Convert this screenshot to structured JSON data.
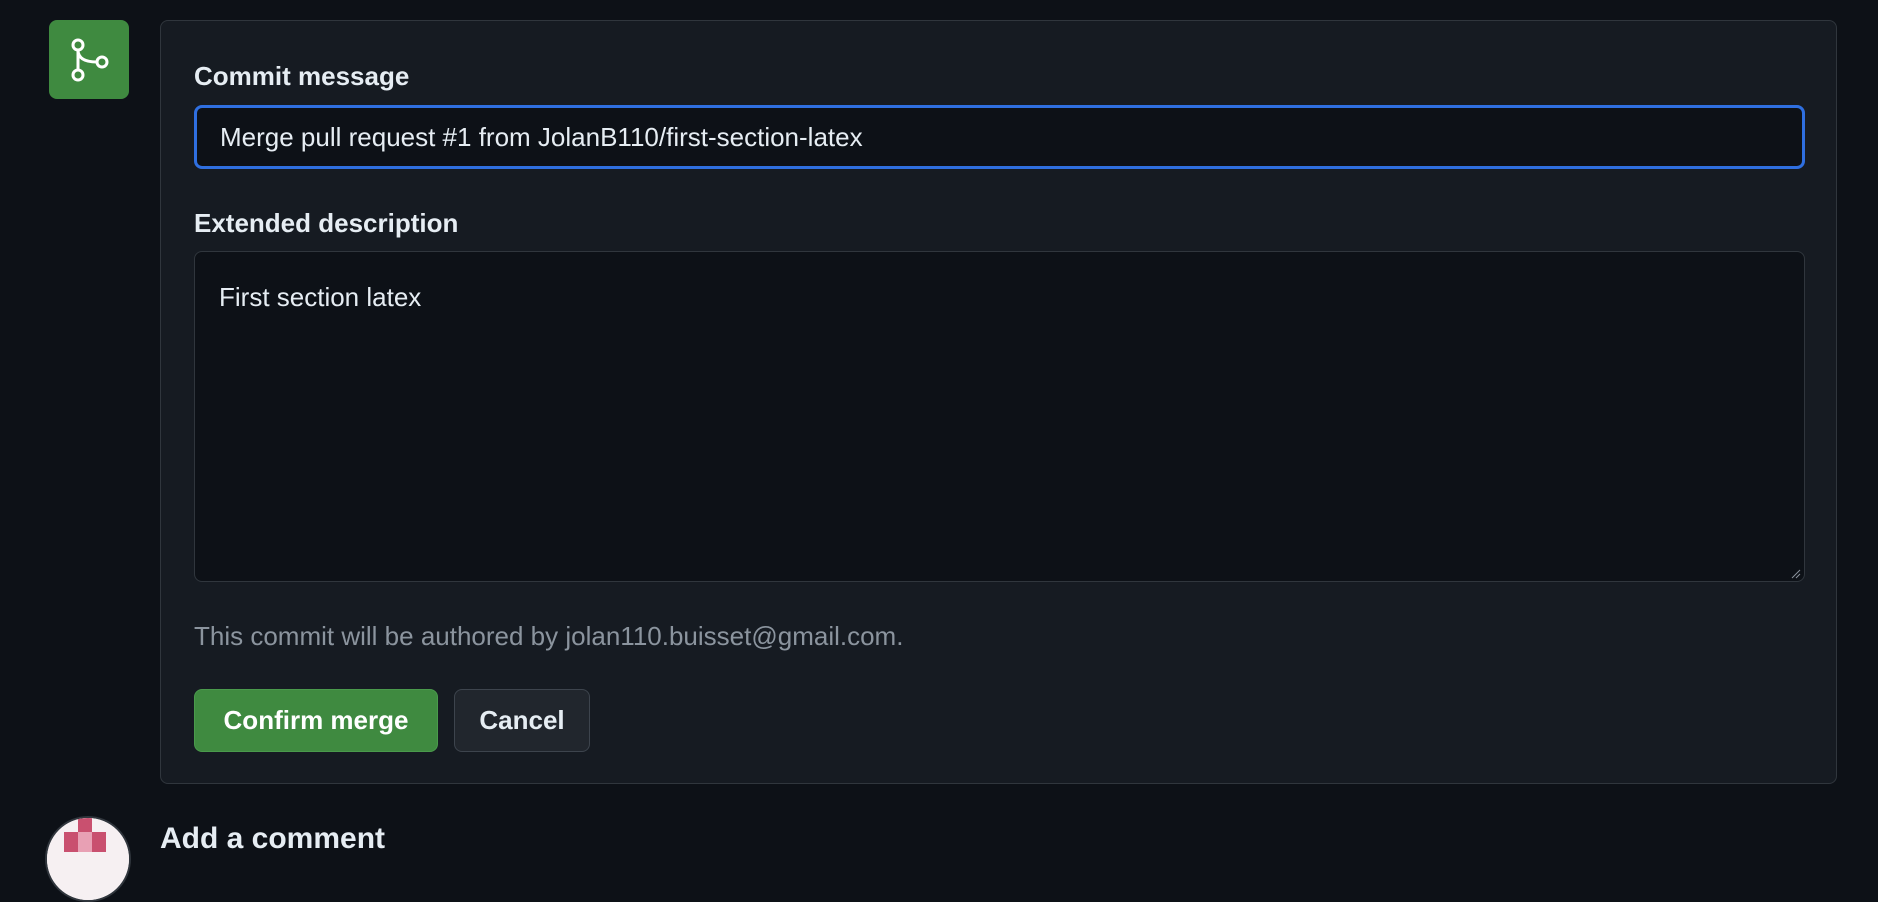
{
  "merge_form": {
    "commit_message_label": "Commit message",
    "commit_message_value": "Merge pull request #1 from JolanB110/first-section-latex",
    "extended_description_label": "Extended description",
    "extended_description_value": "First section latex",
    "author_note": "This commit will be authored by jolan110.buisset@gmail.com.",
    "confirm_label": "Confirm merge",
    "cancel_label": "Cancel"
  },
  "comment_section": {
    "heading": "Add a comment"
  },
  "icons": {
    "merge": "git-merge-icon",
    "avatar": "identicon-avatar"
  },
  "colors": {
    "background": "#0d1117",
    "panel": "#161b22",
    "accent_green": "#3f8a40",
    "focus_blue": "#2f6fe0"
  }
}
